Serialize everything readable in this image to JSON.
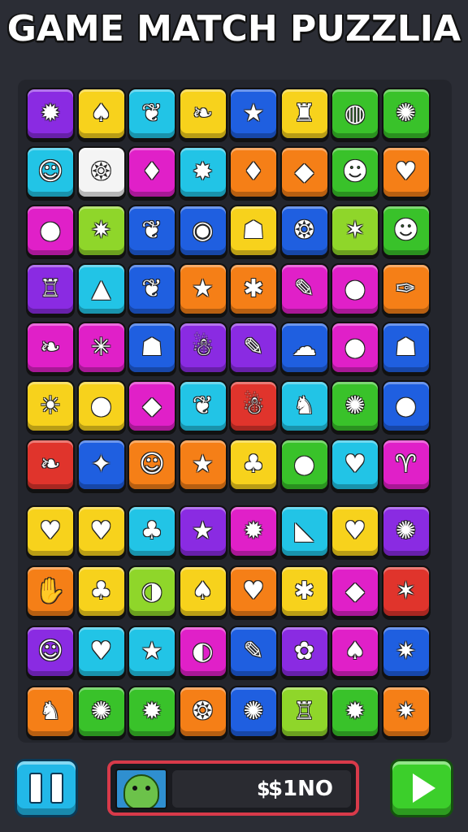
{
  "title": "GAME MATCH PUZZLIA",
  "colors": {
    "purple": "#8a2be2",
    "yellow": "#f7d21c",
    "cyan": "#22c4e6",
    "blue": "#1f5fe0",
    "green": "#39c22a",
    "orange": "#f57f17",
    "magenta": "#e020c8",
    "red": "#e0342c",
    "white": "#f4f4f4",
    "lime": "#8fd62a"
  },
  "board": {
    "rows": [
      [
        {
          "color": "purple",
          "icon": "spiky-creature-icon",
          "glyph": "✹"
        },
        {
          "color": "yellow",
          "icon": "flame-icon",
          "glyph": "♠"
        },
        {
          "color": "cyan",
          "icon": "leaf-creature-icon",
          "glyph": "❦"
        },
        {
          "color": "yellow",
          "icon": "leaf-icon",
          "glyph": "❧"
        },
        {
          "color": "blue",
          "icon": "star-icon",
          "glyph": "★"
        },
        {
          "color": "yellow",
          "icon": "bag-icon",
          "glyph": "♜"
        },
        {
          "color": "green",
          "icon": "planet-icon",
          "glyph": "◍"
        },
        {
          "color": "green",
          "icon": "gear-icon",
          "glyph": "✺"
        }
      ],
      [
        {
          "color": "cyan",
          "icon": "smiley-icon",
          "glyph": "☺"
        },
        {
          "color": "white",
          "icon": "shell-icon",
          "glyph": "❂"
        },
        {
          "color": "magenta",
          "icon": "gem-icon",
          "glyph": "♦"
        },
        {
          "color": "cyan",
          "icon": "burst-icon",
          "glyph": "✸"
        },
        {
          "color": "orange",
          "icon": "drop-icon",
          "glyph": "♦"
        },
        {
          "color": "orange",
          "icon": "crystal-icon",
          "glyph": "◆"
        },
        {
          "color": "green",
          "icon": "cat-face-icon",
          "glyph": "☻"
        },
        {
          "color": "orange",
          "icon": "heart-icon",
          "glyph": "♥"
        }
      ],
      [
        {
          "color": "magenta",
          "icon": "plum-icon",
          "glyph": "●"
        },
        {
          "color": "lime",
          "icon": "spiky-ball-icon",
          "glyph": "✷"
        },
        {
          "color": "blue",
          "icon": "dino-icon",
          "glyph": "❦"
        },
        {
          "color": "blue",
          "icon": "ball-icon",
          "glyph": "◉"
        },
        {
          "color": "yellow",
          "icon": "monster-icon",
          "glyph": "☗"
        },
        {
          "color": "blue",
          "icon": "shell-icon",
          "glyph": "❂"
        },
        {
          "color": "lime",
          "icon": "star-burst-icon",
          "glyph": "✶"
        },
        {
          "color": "green",
          "icon": "monster-icon",
          "glyph": "☻"
        }
      ],
      [
        {
          "color": "purple",
          "icon": "cake-icon",
          "glyph": "♖"
        },
        {
          "color": "cyan",
          "icon": "slime-icon",
          "glyph": "▲"
        },
        {
          "color": "blue",
          "icon": "creature-icon",
          "glyph": "❦"
        },
        {
          "color": "orange",
          "icon": "star-icon",
          "glyph": "★"
        },
        {
          "color": "orange",
          "icon": "leaf-icon",
          "glyph": "✱"
        },
        {
          "color": "magenta",
          "icon": "pencil-icon",
          "glyph": "✎"
        },
        {
          "color": "magenta",
          "icon": "apple-icon",
          "glyph": "●"
        },
        {
          "color": "orange",
          "icon": "pen-icon",
          "glyph": "✑"
        }
      ],
      [
        {
          "color": "magenta",
          "icon": "leaf-icon",
          "glyph": "❧"
        },
        {
          "color": "magenta",
          "icon": "spark-icon",
          "glyph": "✳"
        },
        {
          "color": "blue",
          "icon": "robot-icon",
          "glyph": "☗"
        },
        {
          "color": "purple",
          "icon": "ghost-icon",
          "glyph": "☃"
        },
        {
          "color": "purple",
          "icon": "carrot-icon",
          "glyph": "✎"
        },
        {
          "color": "blue",
          "icon": "cloud-icon",
          "glyph": "☁"
        },
        {
          "color": "magenta",
          "icon": "berry-icon",
          "glyph": "●"
        },
        {
          "color": "blue",
          "icon": "creature-icon",
          "glyph": "☗"
        }
      ],
      [
        {
          "color": "yellow",
          "icon": "sun-icon",
          "glyph": "☀"
        },
        {
          "color": "yellow",
          "icon": "tomato-icon",
          "glyph": "●"
        },
        {
          "color": "magenta",
          "icon": "egg-icon",
          "glyph": "◆"
        },
        {
          "color": "cyan",
          "icon": "leaf-icon",
          "glyph": "❦"
        },
        {
          "color": "red",
          "icon": "ghost-icon",
          "glyph": "☃"
        },
        {
          "color": "cyan",
          "icon": "snake-icon",
          "glyph": "♞"
        },
        {
          "color": "green",
          "icon": "virus-icon",
          "glyph": "✺"
        },
        {
          "color": "blue",
          "icon": "bomb-icon",
          "glyph": "●"
        }
      ],
      [
        {
          "color": "red",
          "icon": "feather-icon",
          "glyph": "❧"
        },
        {
          "color": "blue",
          "icon": "shell-icon",
          "glyph": "✦"
        },
        {
          "color": "orange",
          "icon": "smiley-icon",
          "glyph": "☺"
        },
        {
          "color": "orange",
          "icon": "star-icon",
          "glyph": "★"
        },
        {
          "color": "yellow",
          "icon": "tree-icon",
          "glyph": "♣"
        },
        {
          "color": "green",
          "icon": "apple-icon",
          "glyph": "●"
        },
        {
          "color": "cyan",
          "icon": "heart-icon",
          "glyph": "♥"
        },
        {
          "color": "magenta",
          "icon": "sprout-icon",
          "glyph": "♈"
        }
      ],
      [
        {
          "color": "yellow",
          "icon": "strawberry-icon",
          "glyph": "♥"
        },
        {
          "color": "yellow",
          "icon": "heart-icon",
          "glyph": "♥"
        },
        {
          "color": "cyan",
          "icon": "leaf-icon",
          "glyph": "♣"
        },
        {
          "color": "purple",
          "icon": "star-icon",
          "glyph": "★"
        },
        {
          "color": "magenta",
          "icon": "burst-icon",
          "glyph": "✹"
        },
        {
          "color": "cyan",
          "icon": "boot-icon",
          "glyph": "◣"
        },
        {
          "color": "yellow",
          "icon": "bag-icon",
          "glyph": "♥"
        },
        {
          "color": "purple",
          "icon": "gear-icon",
          "glyph": "✺"
        }
      ],
      [
        {
          "color": "orange",
          "icon": "hand-icon",
          "glyph": "✋"
        },
        {
          "color": "yellow",
          "icon": "leaf-icon",
          "glyph": "♣"
        },
        {
          "color": "lime",
          "icon": "seed-icon",
          "glyph": "◑"
        },
        {
          "color": "yellow",
          "icon": "flame-icon",
          "glyph": "♠"
        },
        {
          "color": "orange",
          "icon": "strawberry-icon",
          "glyph": "♥"
        },
        {
          "color": "yellow",
          "icon": "maple-leaf-icon",
          "glyph": "✱"
        },
        {
          "color": "magenta",
          "icon": "shell-icon",
          "glyph": "◆"
        },
        {
          "color": "red",
          "icon": "starfish-icon",
          "glyph": "✶"
        }
      ],
      [
        {
          "color": "purple",
          "icon": "smiley-icon",
          "glyph": "☺"
        },
        {
          "color": "cyan",
          "icon": "heart-icon",
          "glyph": "♥"
        },
        {
          "color": "cyan",
          "icon": "star-icon",
          "glyph": "★"
        },
        {
          "color": "magenta",
          "icon": "drop-icon",
          "glyph": "◐"
        },
        {
          "color": "blue",
          "icon": "rolling-pin-icon",
          "glyph": "✎"
        },
        {
          "color": "purple",
          "icon": "flower-icon",
          "glyph": "✿"
        },
        {
          "color": "magenta",
          "icon": "mushroom-icon",
          "glyph": "♠"
        },
        {
          "color": "blue",
          "icon": "bug-icon",
          "glyph": "✷"
        }
      ],
      [
        {
          "color": "orange",
          "icon": "chicken-icon",
          "glyph": "♞"
        },
        {
          "color": "green",
          "icon": "flower-icon",
          "glyph": "✺"
        },
        {
          "color": "green",
          "icon": "gear-icon",
          "glyph": "✹"
        },
        {
          "color": "orange",
          "icon": "shell-icon",
          "glyph": "❂"
        },
        {
          "color": "blue",
          "icon": "sun-icon",
          "glyph": "✺"
        },
        {
          "color": "lime",
          "icon": "cupcake-icon",
          "glyph": "♖"
        },
        {
          "color": "green",
          "icon": "gear-icon",
          "glyph": "✹"
        },
        {
          "color": "orange",
          "icon": "burst-icon",
          "glyph": "✷"
        }
      ]
    ]
  },
  "footer": {
    "currency_symbol": "$",
    "score": "$1NO",
    "pause_icon": "pause-icon",
    "play_icon": "play-icon",
    "avatar_icon": "goblin-avatar-icon"
  }
}
